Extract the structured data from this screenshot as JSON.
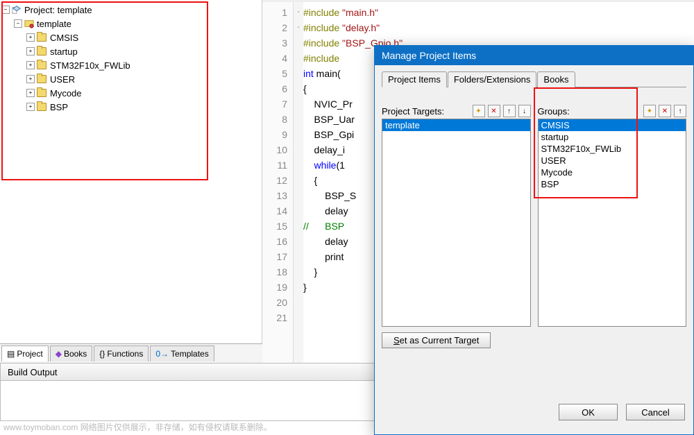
{
  "project_tree": {
    "root_label": "Project: template",
    "template_label": "template",
    "items": [
      "CMSIS",
      "startup",
      "STM32F10x_FWLib",
      "USER",
      "Mycode",
      "BSP"
    ]
  },
  "bottom_tabs": {
    "project": "Project",
    "books": "Books",
    "functions": "Functions",
    "templates": "Templates"
  },
  "build_output_title": "Build Output",
  "editor": {
    "lines": [
      {
        "n": 1,
        "pp": "#include ",
        "str": "\"main.h\""
      },
      {
        "n": 2,
        "pp": "#include ",
        "str": "\"delay.h\""
      },
      {
        "n": 3,
        "pp": "#include ",
        "str": "\"BSP_Gpio.h\""
      },
      {
        "n": 4,
        "pp": "#include "
      },
      {
        "n": 5,
        "kw": "int",
        "txt": " main("
      },
      {
        "n": 6,
        "txt": "{",
        "fold": "-"
      },
      {
        "n": 7,
        "txt": "    NVIC_Pr"
      },
      {
        "n": 8,
        "txt": "    BSP_Uar"
      },
      {
        "n": 9,
        "txt": "    BSP_Gpi"
      },
      {
        "n": 10,
        "txt": "    delay_i"
      },
      {
        "n": 11,
        "kw": "    while",
        "txt": "(1"
      },
      {
        "n": 12,
        "txt": "    {",
        "fold": "-"
      },
      {
        "n": 13,
        "txt": "        BSP_S"
      },
      {
        "n": 14,
        "txt": "        delay"
      },
      {
        "n": 15,
        "cmt": "//      BSP"
      },
      {
        "n": 16,
        "txt": "        delay"
      },
      {
        "n": 17,
        "txt": "        print"
      },
      {
        "n": 18,
        "txt": "    }"
      },
      {
        "n": 19,
        "txt": "}"
      },
      {
        "n": 20,
        "txt": ""
      },
      {
        "n": 21,
        "txt": ""
      }
    ]
  },
  "dialog": {
    "title": "Manage Project Items",
    "tabs": {
      "items": "Project Items",
      "folders": "Folders/Extensions",
      "books": "Books"
    },
    "targets_label": "Project Targets:",
    "groups_label": "Groups:",
    "targets": [
      "template"
    ],
    "groups": [
      "CMSIS",
      "startup",
      "STM32F10x_FWLib",
      "USER",
      "Mycode",
      "BSP"
    ],
    "set_target": "Set as Current Target",
    "ok": "OK",
    "cancel": "Cancel"
  },
  "watermark": "www.toymoban.com   网络图片仅供展示，非存储，如有侵权请联系删除。"
}
